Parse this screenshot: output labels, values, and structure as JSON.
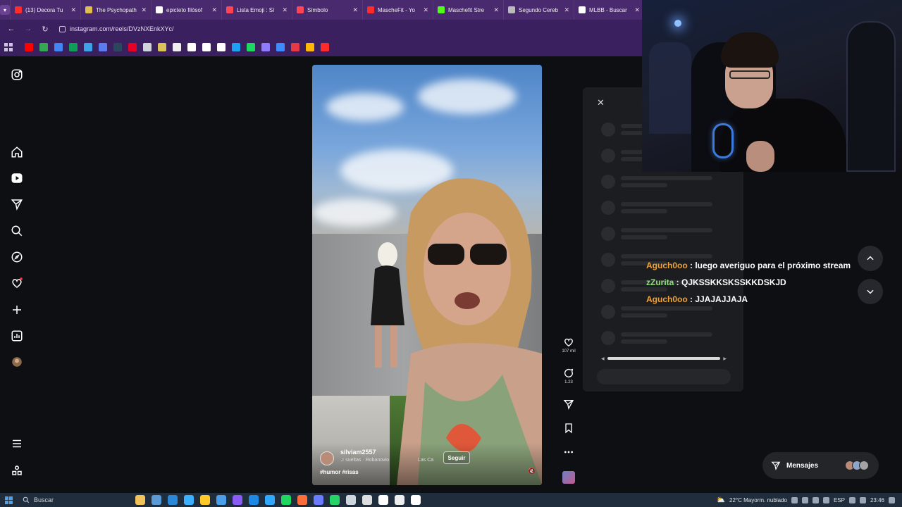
{
  "browser": {
    "tabs": [
      {
        "title": "(13) Decora Tu",
        "fav": "#ff2b2b"
      },
      {
        "title": "The Psychopath",
        "fav": "#e0c04a"
      },
      {
        "title": "epicteto filósof",
        "fav": "#ffffff"
      },
      {
        "title": "Lista Emoji : Sí",
        "fav": "#ff4455"
      },
      {
        "title": "Símbolo",
        "fav": "#ff4455"
      },
      {
        "title": "MascheFit - Yo",
        "fav": "#ff2b2b"
      },
      {
        "title": "Maschefit Stre",
        "fav": "#53fc18"
      },
      {
        "title": "Segundo Cereb",
        "fav": "#bbbbbb"
      },
      {
        "title": "MLBB - Buscar",
        "fav": "#ffffff"
      }
    ],
    "url": "instagram.com/reels/DVzNXEnkXYc/",
    "bookmark_colors": [
      "#ff0000",
      "#34a853",
      "#4285f4",
      "#0f9d58",
      "#3ca3e8",
      "#5b7cf0",
      "#2a475e",
      "#e60023",
      "#cfd3da",
      "#d9c25a",
      "#eeeeee",
      "#ffffff",
      "#ffffff",
      "#ffffff",
      "#1da1f2",
      "#1ed760",
      "#8f7bff",
      "#3e8bff",
      "#e63946",
      "#ffb703",
      "#ff2b2b"
    ]
  },
  "ig_nav": {
    "icons": [
      "instagram-icon",
      "home-icon",
      "reels-icon",
      "send-icon",
      "search-icon",
      "explore-icon",
      "heart-icon",
      "create-icon",
      "dashboard-icon",
      "profile-avatar",
      "menu-icon",
      "apps-icon"
    ]
  },
  "reel": {
    "username": "silviam2557",
    "music": "♫ sueltas · Robanovio",
    "location": "Las Ca",
    "follow_label": "Seguir",
    "hashtags": "#humor #risas",
    "likes": "107 mil",
    "comments": "1.23"
  },
  "stream_chat": [
    {
      "name": "Aguch0oo",
      "text": " : luego averiguo para el próximo stream",
      "color": "#f0a23a"
    },
    {
      "name": "zZurita",
      "text": " : QJKSSKKSKSSKKDSKJD",
      "color": "#8ee07a"
    },
    {
      "name": "Aguch0oo",
      "text": " : JJAJAJJAJA",
      "color": "#f0a23a"
    }
  ],
  "messages": {
    "label": "Mensajes"
  },
  "taskbar": {
    "search_label": "Buscar",
    "weather": "22°C  Mayorm. nublado",
    "lang": "ESP",
    "time": "23:46",
    "app_colors": [
      "#f2c25a",
      "#5b9bd5",
      "#2b88d8",
      "#3ab0ff",
      "#ffca28",
      "#4b9fe8",
      "#8a5cf5",
      "#1e88e5",
      "#31a8ff",
      "#1ed760",
      "#ff6d3a",
      "#6b7bff",
      "#25d366",
      "#cfd6de",
      "#dddddd",
      "#ffffff",
      "#eeeeee",
      "#ffffff"
    ]
  }
}
